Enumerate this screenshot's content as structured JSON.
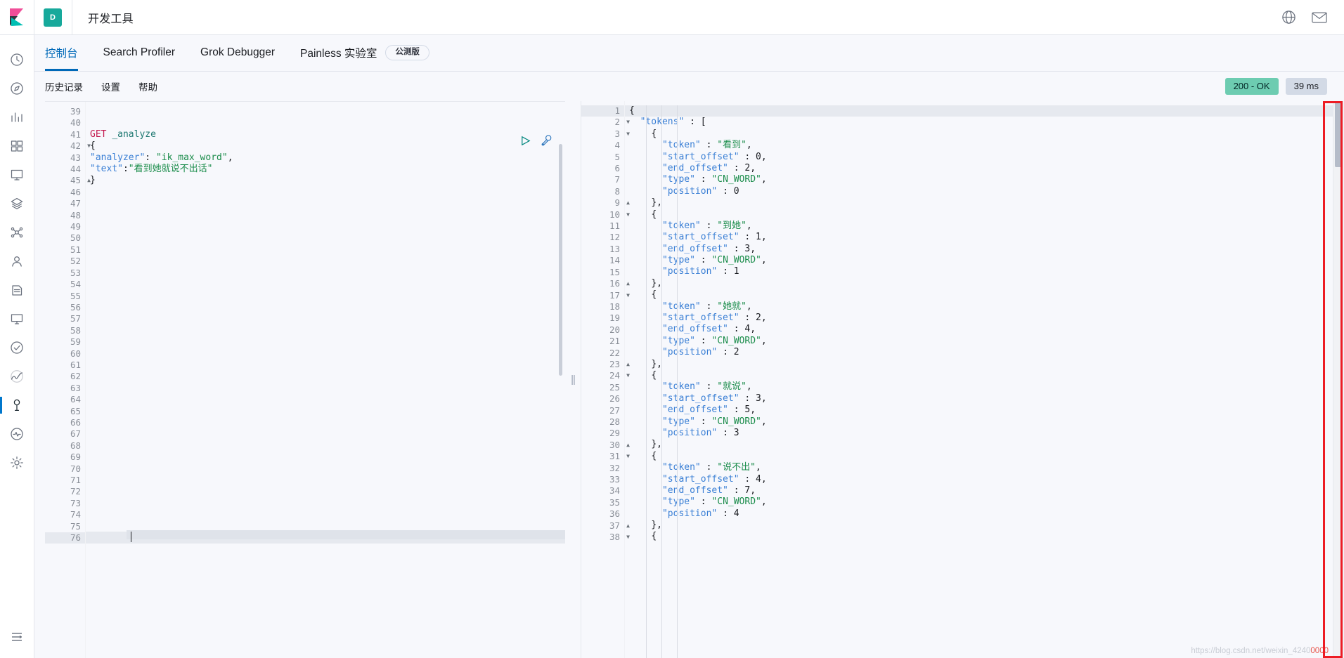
{
  "app": {
    "logo_icon": "kibana-logo",
    "space_badge": "D",
    "header_title": "开发工具",
    "header_icons": [
      {
        "name": "help-globe-icon",
        "glyph": "globe"
      },
      {
        "name": "mail-icon",
        "glyph": "mail"
      }
    ]
  },
  "nav_rail": {
    "items": [
      {
        "name": "sidebar-item-recent",
        "icon": "clock-icon"
      },
      {
        "name": "sidebar-item-discover",
        "icon": "compass-icon"
      },
      {
        "name": "sidebar-item-visualize",
        "icon": "bar-chart-icon"
      },
      {
        "name": "sidebar-item-dashboard",
        "icon": "dashboard-icon"
      },
      {
        "name": "sidebar-item-canvas",
        "icon": "canvas-icon"
      },
      {
        "name": "sidebar-item-maps",
        "icon": "layers-icon"
      },
      {
        "name": "sidebar-item-ml",
        "icon": "ml-icon"
      },
      {
        "name": "sidebar-item-infrastructure",
        "icon": "user-icon"
      },
      {
        "name": "sidebar-item-logs",
        "icon": "logs-icon"
      },
      {
        "name": "sidebar-item-metrics",
        "icon": "monitor-icon"
      },
      {
        "name": "sidebar-item-uptime",
        "icon": "check-icon"
      },
      {
        "name": "sidebar-item-apm",
        "icon": "apm-icon"
      },
      {
        "name": "sidebar-item-dev-tools",
        "icon": "wrench-icon"
      },
      {
        "name": "sidebar-item-monitoring",
        "icon": "heartbeat-icon"
      },
      {
        "name": "sidebar-item-management",
        "icon": "gear-icon"
      }
    ],
    "collapse": {
      "name": "collapse-nav-button",
      "icon": "collapse-icon"
    },
    "active_index": 12
  },
  "tabs": [
    {
      "label": "控制台",
      "active": true,
      "badge": null
    },
    {
      "label": "Search Profiler",
      "active": false,
      "badge": null
    },
    {
      "label": "Grok Debugger",
      "active": false,
      "badge": null
    },
    {
      "label": "Painless 实验室",
      "active": false,
      "badge": "公测版"
    }
  ],
  "subnav": {
    "links": [
      "历史记录",
      "设置",
      "帮助"
    ],
    "status": "200 - OK",
    "time": "39 ms"
  },
  "request_editor": {
    "first_line_number": 39,
    "last_line_number": 76,
    "current_line": 76,
    "folded_lines": [
      42,
      45
    ],
    "fold_open": [
      42
    ],
    "fold_close": [
      45
    ],
    "actions": [
      {
        "name": "send-request-button",
        "icon": "play-icon"
      },
      {
        "name": "request-options-button",
        "icon": "wrench-icon"
      }
    ],
    "lines": [
      {
        "n": 39,
        "tokens": []
      },
      {
        "n": 40,
        "tokens": []
      },
      {
        "n": 41,
        "tokens": [
          {
            "t": "GET ",
            "c": "k-method"
          },
          {
            "t": "_analyze",
            "c": "k-url"
          }
        ]
      },
      {
        "n": 42,
        "tokens": [
          {
            "t": "{",
            "c": "k-punc"
          }
        ]
      },
      {
        "n": 43,
        "tokens": [
          {
            "t": "\"analyzer\"",
            "c": "k-key"
          },
          {
            "t": ": ",
            "c": "k-punc"
          },
          {
            "t": "\"ik_max_word\"",
            "c": "k-str"
          },
          {
            "t": ",",
            "c": "k-punc"
          }
        ]
      },
      {
        "n": 44,
        "tokens": [
          {
            "t": "\"text\"",
            "c": "k-key"
          },
          {
            "t": ":",
            "c": "k-punc"
          },
          {
            "t": "\"看到她就说不出话\"",
            "c": "k-str"
          }
        ]
      },
      {
        "n": 45,
        "tokens": [
          {
            "t": "}",
            "c": "k-punc"
          }
        ]
      },
      {
        "n": 46,
        "tokens": []
      },
      {
        "n": 47,
        "tokens": []
      },
      {
        "n": 48,
        "tokens": []
      },
      {
        "n": 49,
        "tokens": []
      },
      {
        "n": 50,
        "tokens": []
      },
      {
        "n": 51,
        "tokens": []
      },
      {
        "n": 52,
        "tokens": []
      },
      {
        "n": 53,
        "tokens": []
      },
      {
        "n": 54,
        "tokens": []
      },
      {
        "n": 55,
        "tokens": []
      },
      {
        "n": 56,
        "tokens": []
      },
      {
        "n": 57,
        "tokens": []
      },
      {
        "n": 58,
        "tokens": []
      },
      {
        "n": 59,
        "tokens": []
      },
      {
        "n": 60,
        "tokens": []
      },
      {
        "n": 61,
        "tokens": []
      },
      {
        "n": 62,
        "tokens": []
      },
      {
        "n": 63,
        "tokens": []
      },
      {
        "n": 64,
        "tokens": []
      },
      {
        "n": 65,
        "tokens": []
      },
      {
        "n": 66,
        "tokens": []
      },
      {
        "n": 67,
        "tokens": []
      },
      {
        "n": 68,
        "tokens": []
      },
      {
        "n": 69,
        "tokens": []
      },
      {
        "n": 70,
        "tokens": []
      },
      {
        "n": 71,
        "tokens": []
      },
      {
        "n": 72,
        "tokens": []
      },
      {
        "n": 73,
        "tokens": []
      },
      {
        "n": 74,
        "tokens": []
      },
      {
        "n": 75,
        "tokens": []
      },
      {
        "n": 76,
        "tokens": []
      }
    ]
  },
  "response_editor": {
    "first_line_number": 1,
    "last_line_number": 38,
    "current_line": 1,
    "lines": [
      {
        "n": 1,
        "fold": "open",
        "indent": 0,
        "tokens": [
          {
            "t": "{",
            "c": "k-punc"
          }
        ]
      },
      {
        "n": 2,
        "fold": "open",
        "indent": 1,
        "tokens": [
          {
            "t": "\"tokens\"",
            "c": "k-key"
          },
          {
            "t": " : ",
            "c": "k-punc"
          },
          {
            "t": "[",
            "c": "k-punc"
          }
        ]
      },
      {
        "n": 3,
        "fold": "open",
        "indent": 2,
        "tokens": [
          {
            "t": "{",
            "c": "k-punc"
          }
        ]
      },
      {
        "n": 4,
        "fold": null,
        "indent": 3,
        "tokens": [
          {
            "t": "\"token\"",
            "c": "k-key"
          },
          {
            "t": " : ",
            "c": "k-punc"
          },
          {
            "t": "\"看到\"",
            "c": "k-str"
          },
          {
            "t": ",",
            "c": "k-punc"
          }
        ]
      },
      {
        "n": 5,
        "fold": null,
        "indent": 3,
        "tokens": [
          {
            "t": "\"start_offset\"",
            "c": "k-key"
          },
          {
            "t": " : ",
            "c": "k-punc"
          },
          {
            "t": "0",
            "c": "k-num"
          },
          {
            "t": ",",
            "c": "k-punc"
          }
        ]
      },
      {
        "n": 6,
        "fold": null,
        "indent": 3,
        "tokens": [
          {
            "t": "\"end_offset\"",
            "c": "k-key"
          },
          {
            "t": " : ",
            "c": "k-punc"
          },
          {
            "t": "2",
            "c": "k-num"
          },
          {
            "t": ",",
            "c": "k-punc"
          }
        ]
      },
      {
        "n": 7,
        "fold": null,
        "indent": 3,
        "tokens": [
          {
            "t": "\"type\"",
            "c": "k-key"
          },
          {
            "t": " : ",
            "c": "k-punc"
          },
          {
            "t": "\"CN_WORD\"",
            "c": "k-str"
          },
          {
            "t": ",",
            "c": "k-punc"
          }
        ]
      },
      {
        "n": 8,
        "fold": null,
        "indent": 3,
        "tokens": [
          {
            "t": "\"position\"",
            "c": "k-key"
          },
          {
            "t": " : ",
            "c": "k-punc"
          },
          {
            "t": "0",
            "c": "k-num"
          }
        ]
      },
      {
        "n": 9,
        "fold": "close",
        "indent": 2,
        "tokens": [
          {
            "t": "},",
            "c": "k-punc"
          }
        ]
      },
      {
        "n": 10,
        "fold": "open",
        "indent": 2,
        "tokens": [
          {
            "t": "{",
            "c": "k-punc"
          }
        ]
      },
      {
        "n": 11,
        "fold": null,
        "indent": 3,
        "tokens": [
          {
            "t": "\"token\"",
            "c": "k-key"
          },
          {
            "t": " : ",
            "c": "k-punc"
          },
          {
            "t": "\"到她\"",
            "c": "k-str"
          },
          {
            "t": ",",
            "c": "k-punc"
          }
        ]
      },
      {
        "n": 12,
        "fold": null,
        "indent": 3,
        "tokens": [
          {
            "t": "\"start_offset\"",
            "c": "k-key"
          },
          {
            "t": " : ",
            "c": "k-punc"
          },
          {
            "t": "1",
            "c": "k-num"
          },
          {
            "t": ",",
            "c": "k-punc"
          }
        ]
      },
      {
        "n": 13,
        "fold": null,
        "indent": 3,
        "tokens": [
          {
            "t": "\"end_offset\"",
            "c": "k-key"
          },
          {
            "t": " : ",
            "c": "k-punc"
          },
          {
            "t": "3",
            "c": "k-num"
          },
          {
            "t": ",",
            "c": "k-punc"
          }
        ]
      },
      {
        "n": 14,
        "fold": null,
        "indent": 3,
        "tokens": [
          {
            "t": "\"type\"",
            "c": "k-key"
          },
          {
            "t": " : ",
            "c": "k-punc"
          },
          {
            "t": "\"CN_WORD\"",
            "c": "k-str"
          },
          {
            "t": ",",
            "c": "k-punc"
          }
        ]
      },
      {
        "n": 15,
        "fold": null,
        "indent": 3,
        "tokens": [
          {
            "t": "\"position\"",
            "c": "k-key"
          },
          {
            "t": " : ",
            "c": "k-punc"
          },
          {
            "t": "1",
            "c": "k-num"
          }
        ]
      },
      {
        "n": 16,
        "fold": "close",
        "indent": 2,
        "tokens": [
          {
            "t": "},",
            "c": "k-punc"
          }
        ]
      },
      {
        "n": 17,
        "fold": "open",
        "indent": 2,
        "tokens": [
          {
            "t": "{",
            "c": "k-punc"
          }
        ]
      },
      {
        "n": 18,
        "fold": null,
        "indent": 3,
        "tokens": [
          {
            "t": "\"token\"",
            "c": "k-key"
          },
          {
            "t": " : ",
            "c": "k-punc"
          },
          {
            "t": "\"她就\"",
            "c": "k-str"
          },
          {
            "t": ",",
            "c": "k-punc"
          }
        ]
      },
      {
        "n": 19,
        "fold": null,
        "indent": 3,
        "tokens": [
          {
            "t": "\"start_offset\"",
            "c": "k-key"
          },
          {
            "t": " : ",
            "c": "k-punc"
          },
          {
            "t": "2",
            "c": "k-num"
          },
          {
            "t": ",",
            "c": "k-punc"
          }
        ]
      },
      {
        "n": 20,
        "fold": null,
        "indent": 3,
        "tokens": [
          {
            "t": "\"end_offset\"",
            "c": "k-key"
          },
          {
            "t": " : ",
            "c": "k-punc"
          },
          {
            "t": "4",
            "c": "k-num"
          },
          {
            "t": ",",
            "c": "k-punc"
          }
        ]
      },
      {
        "n": 21,
        "fold": null,
        "indent": 3,
        "tokens": [
          {
            "t": "\"type\"",
            "c": "k-key"
          },
          {
            "t": " : ",
            "c": "k-punc"
          },
          {
            "t": "\"CN_WORD\"",
            "c": "k-str"
          },
          {
            "t": ",",
            "c": "k-punc"
          }
        ]
      },
      {
        "n": 22,
        "fold": null,
        "indent": 3,
        "tokens": [
          {
            "t": "\"position\"",
            "c": "k-key"
          },
          {
            "t": " : ",
            "c": "k-punc"
          },
          {
            "t": "2",
            "c": "k-num"
          }
        ]
      },
      {
        "n": 23,
        "fold": "close",
        "indent": 2,
        "tokens": [
          {
            "t": "},",
            "c": "k-punc"
          }
        ]
      },
      {
        "n": 24,
        "fold": "open",
        "indent": 2,
        "tokens": [
          {
            "t": "{",
            "c": "k-punc"
          }
        ]
      },
      {
        "n": 25,
        "fold": null,
        "indent": 3,
        "tokens": [
          {
            "t": "\"token\"",
            "c": "k-key"
          },
          {
            "t": " : ",
            "c": "k-punc"
          },
          {
            "t": "\"就说\"",
            "c": "k-str"
          },
          {
            "t": ",",
            "c": "k-punc"
          }
        ]
      },
      {
        "n": 26,
        "fold": null,
        "indent": 3,
        "tokens": [
          {
            "t": "\"start_offset\"",
            "c": "k-key"
          },
          {
            "t": " : ",
            "c": "k-punc"
          },
          {
            "t": "3",
            "c": "k-num"
          },
          {
            "t": ",",
            "c": "k-punc"
          }
        ]
      },
      {
        "n": 27,
        "fold": null,
        "indent": 3,
        "tokens": [
          {
            "t": "\"end_offset\"",
            "c": "k-key"
          },
          {
            "t": " : ",
            "c": "k-punc"
          },
          {
            "t": "5",
            "c": "k-num"
          },
          {
            "t": ",",
            "c": "k-punc"
          }
        ]
      },
      {
        "n": 28,
        "fold": null,
        "indent": 3,
        "tokens": [
          {
            "t": "\"type\"",
            "c": "k-key"
          },
          {
            "t": " : ",
            "c": "k-punc"
          },
          {
            "t": "\"CN_WORD\"",
            "c": "k-str"
          },
          {
            "t": ",",
            "c": "k-punc"
          }
        ]
      },
      {
        "n": 29,
        "fold": null,
        "indent": 3,
        "tokens": [
          {
            "t": "\"position\"",
            "c": "k-key"
          },
          {
            "t": " : ",
            "c": "k-punc"
          },
          {
            "t": "3",
            "c": "k-num"
          }
        ]
      },
      {
        "n": 30,
        "fold": "close",
        "indent": 2,
        "tokens": [
          {
            "t": "},",
            "c": "k-punc"
          }
        ]
      },
      {
        "n": 31,
        "fold": "open",
        "indent": 2,
        "tokens": [
          {
            "t": "{",
            "c": "k-punc"
          }
        ]
      },
      {
        "n": 32,
        "fold": null,
        "indent": 3,
        "tokens": [
          {
            "t": "\"token\"",
            "c": "k-key"
          },
          {
            "t": " : ",
            "c": "k-punc"
          },
          {
            "t": "\"说不出\"",
            "c": "k-str"
          },
          {
            "t": ",",
            "c": "k-punc"
          }
        ]
      },
      {
        "n": 33,
        "fold": null,
        "indent": 3,
        "tokens": [
          {
            "t": "\"start_offset\"",
            "c": "k-key"
          },
          {
            "t": " : ",
            "c": "k-punc"
          },
          {
            "t": "4",
            "c": "k-num"
          },
          {
            "t": ",",
            "c": "k-punc"
          }
        ]
      },
      {
        "n": 34,
        "fold": null,
        "indent": 3,
        "tokens": [
          {
            "t": "\"end_offset\"",
            "c": "k-key"
          },
          {
            "t": " : ",
            "c": "k-punc"
          },
          {
            "t": "7",
            "c": "k-num"
          },
          {
            "t": ",",
            "c": "k-punc"
          }
        ]
      },
      {
        "n": 35,
        "fold": null,
        "indent": 3,
        "tokens": [
          {
            "t": "\"type\"",
            "c": "k-key"
          },
          {
            "t": " : ",
            "c": "k-punc"
          },
          {
            "t": "\"CN_WORD\"",
            "c": "k-str"
          },
          {
            "t": ",",
            "c": "k-punc"
          }
        ]
      },
      {
        "n": 36,
        "fold": null,
        "indent": 3,
        "tokens": [
          {
            "t": "\"position\"",
            "c": "k-key"
          },
          {
            "t": " : ",
            "c": "k-punc"
          },
          {
            "t": "4",
            "c": "k-num"
          }
        ]
      },
      {
        "n": 37,
        "fold": "close",
        "indent": 2,
        "tokens": [
          {
            "t": "},",
            "c": "k-punc"
          }
        ]
      },
      {
        "n": 38,
        "fold": "open",
        "indent": 2,
        "tokens": [
          {
            "t": "{",
            "c": "k-punc"
          }
        ]
      }
    ]
  },
  "annotation": {
    "name": "red-highlight-rect",
    "color": "#ed1c24"
  },
  "watermark": {
    "text": "https://blog.csdn.net/weixin_4240",
    "red_suffix": "0000"
  },
  "colors": {
    "accent": "#0069b8",
    "brand_teal": "#17a99b",
    "status_ok": "#6dccb1",
    "pill_gray": "#d3dae6",
    "editor_bg": "#f7f8fc"
  }
}
